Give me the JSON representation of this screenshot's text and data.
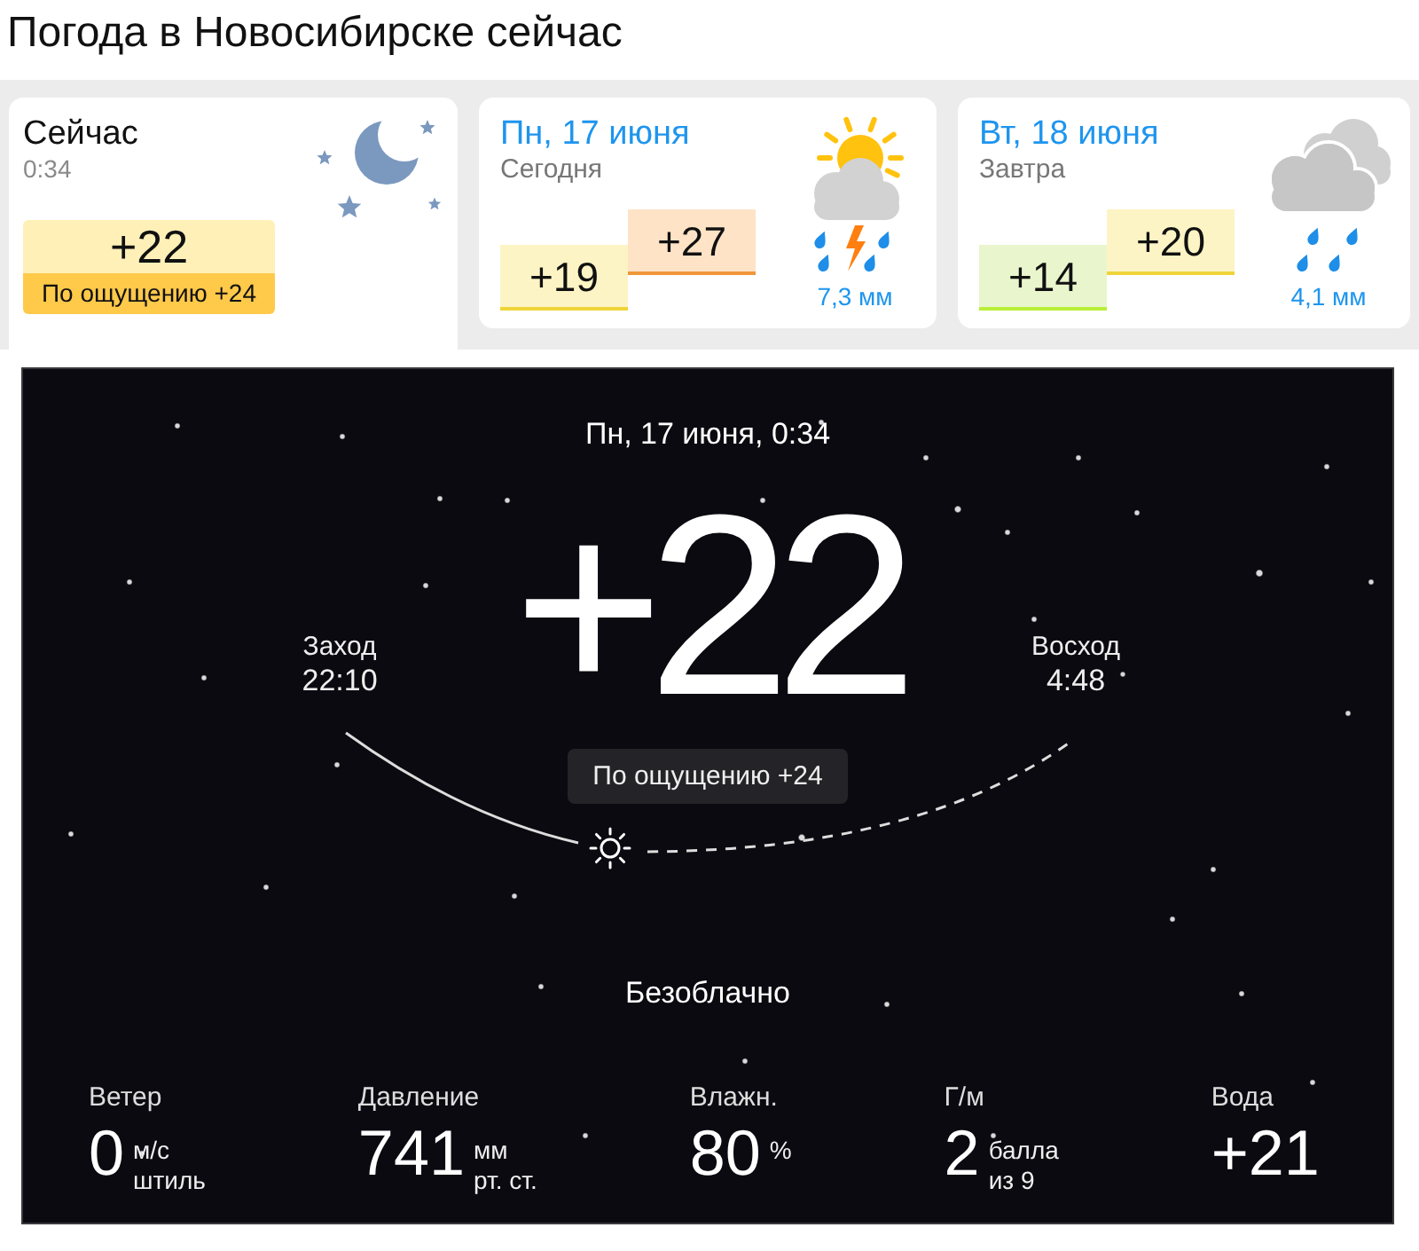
{
  "page_title": "Погода в Новосибирске сейчас",
  "now_card": {
    "title": "Сейчас",
    "time": "0:34",
    "temperature": "+22",
    "feels_like": "По ощущению +24"
  },
  "forecast": [
    {
      "date": "Пн, 17 июня",
      "day_label": "Сегодня",
      "kind": "thunderstorm",
      "temperatures": [
        {
          "value": "+19",
          "color": "#fcf4c4"
        },
        {
          "value": "+27",
          "color": "#fee3c6"
        }
      ],
      "precipitation": "7,3 мм"
    },
    {
      "date": "Вт, 18 июня",
      "day_label": "Завтра",
      "kind": "rain",
      "temperatures": [
        {
          "value": "+14",
          "color": "#e9f5cc"
        },
        {
          "value": "+20",
          "color": "#fcf4c4"
        }
      ],
      "precipitation": "4,1 мм"
    }
  ],
  "current": {
    "datetime": "Пн, 17 июня, 0:34",
    "temperature": "+22",
    "sunset": {
      "label": "Заход",
      "time": "22:10"
    },
    "sunrise": {
      "label": "Восход",
      "time": "4:48"
    },
    "feels_like": "По ощущению +24",
    "condition": "Безоблачно",
    "stats": [
      {
        "label": "Ветер",
        "value": "0",
        "units": [
          "м/с",
          "штиль"
        ]
      },
      {
        "label": "Давление",
        "value": "741",
        "units": [
          "мм",
          "рт. ст."
        ]
      },
      {
        "label": "Влажн.",
        "value": "80",
        "units": [
          "%"
        ]
      },
      {
        "label": "Г/м",
        "value": "2",
        "units": [
          "балла",
          "из 9"
        ]
      },
      {
        "label": "Вода",
        "value": "+21"
      }
    ]
  }
}
